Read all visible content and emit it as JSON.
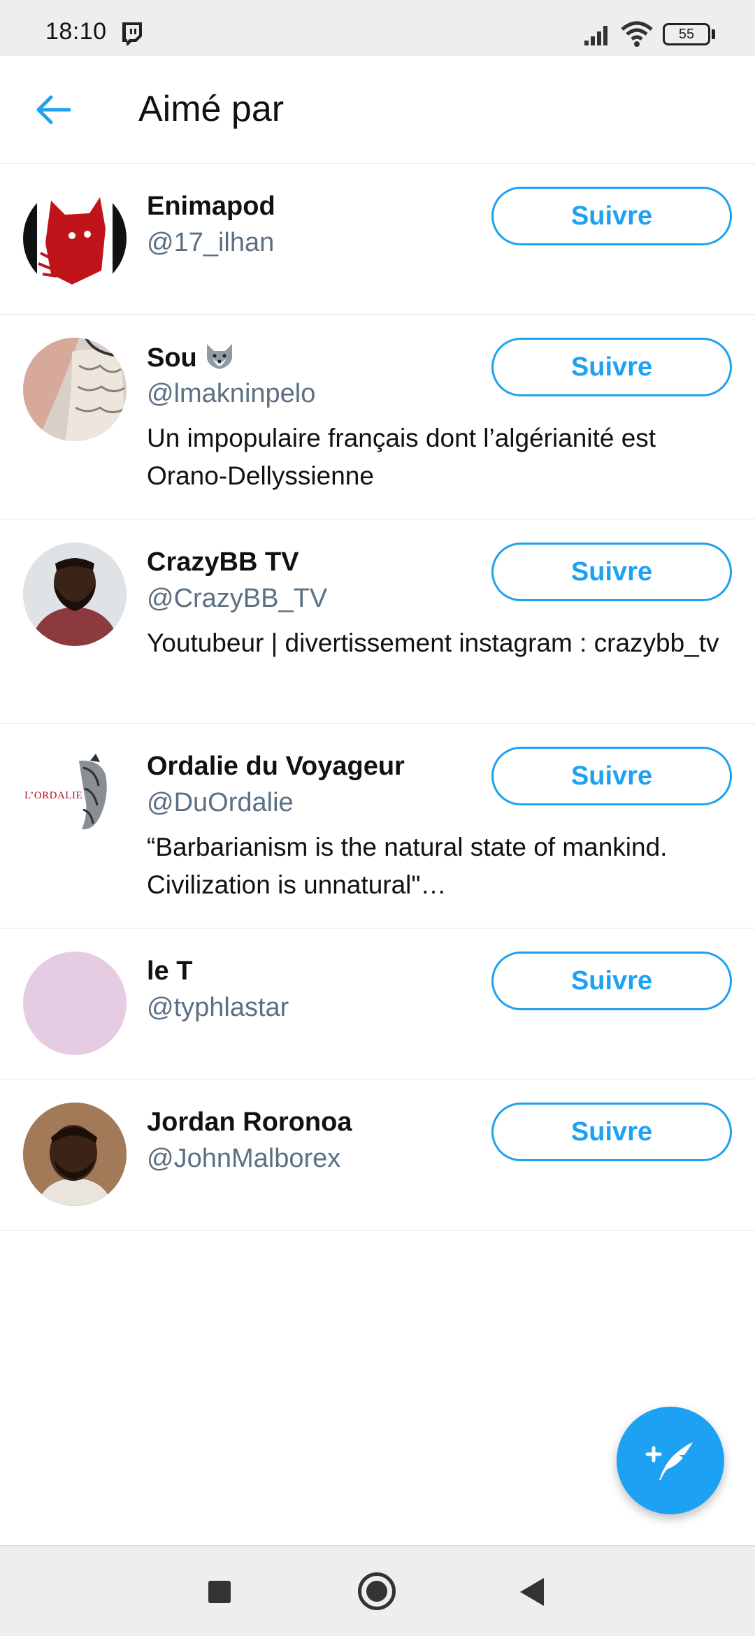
{
  "status_bar": {
    "time": "18:10",
    "battery": "55",
    "icons": [
      "twitch-icon",
      "signal-icon",
      "wifi-icon",
      "battery-icon"
    ]
  },
  "header": {
    "title": "Aimé par",
    "back_icon": "arrow-left-icon"
  },
  "users": [
    {
      "name": "Enimapod",
      "handle": "@17_ilhan",
      "bio": "",
      "follow_label": "Suivre",
      "avatar_color": "#c0141a"
    },
    {
      "name": "Sou",
      "handle": "@lmakninpelo",
      "bio": "Un impopulaire français dont l’algérianité est Orano-Dellyssienne",
      "follow_label": "Suivre",
      "avatar_color": "#b8a39a"
    },
    {
      "name": "CrazyBB TV",
      "handle": "@CrazyBB_TV",
      "bio": "Youtubeur | divertissement instagram : crazybb_tv",
      "follow_label": "Suivre",
      "avatar_color": "#8c3a3e"
    },
    {
      "name": "Ordalie du Voyageur",
      "handle": "@DuOrdalie",
      "bio": "“Barbarianism is the natural state of mankind. Civilization is unnatural\"…",
      "follow_label": "Suivre",
      "avatar_color": "#ffffff"
    },
    {
      "name": "le T",
      "handle": "@typhlastar",
      "bio": "",
      "follow_label": "Suivre",
      "avatar_color": "#e6cce3"
    },
    {
      "name": "Jordan Roronoa",
      "handle": "@JohnMalborex",
      "bio": "",
      "follow_label": "Suivre",
      "avatar_color": "#7a5236"
    }
  ],
  "ordalie_logo_text": "L’ORDALIE",
  "fab": {
    "icon": "compose-tweet-icon"
  },
  "nav_bar": {
    "icons": [
      "recents-icon",
      "home-icon",
      "back-icon"
    ]
  },
  "colors": {
    "accent": "#1da1f2",
    "handle": "#5b7083",
    "divider": "#e1e5e8"
  }
}
